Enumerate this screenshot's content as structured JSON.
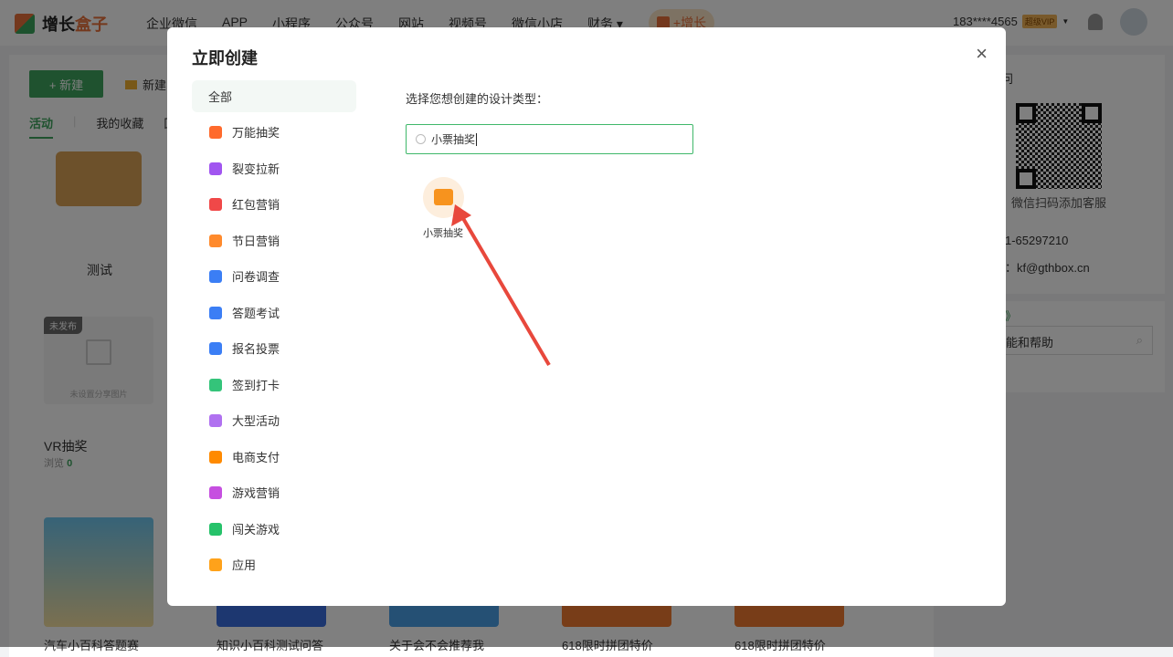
{
  "header": {
    "logo_a": "增长",
    "logo_b": "盒子",
    "nav": [
      "企业微信",
      "APP",
      "小程序",
      "公众号",
      "网站",
      "视频号",
      "微信小店",
      "财务 ▾"
    ],
    "grow": "+增长",
    "user": "183****4565",
    "vip": "超级VIP"
  },
  "page": {
    "new_btn": "+ 新建",
    "new_folder": "新建",
    "tabs": [
      "活动",
      "我的收藏",
      "回"
    ],
    "folder": "测试",
    "card1": {
      "tag": "未发布",
      "placeholder": "未设置分享图片",
      "title": "VR抽奖",
      "views_label": "浏览",
      "views": "0"
    },
    "cards": [
      "汽车小百科答题赛",
      "知识小百科测试问答",
      "关于会不会推荐我",
      "618限时拼团特价",
      "618限时拼团特价"
    ]
  },
  "right": {
    "title": "问",
    "qr_label": "微信扫码添加客服",
    "phone": "1-65297210",
    "email": "：kf@gthbox.cn",
    "help_title": "》",
    "help_search": "能和帮助"
  },
  "modal": {
    "title": "立即创建",
    "close": "×",
    "categories": [
      {
        "label": "全部",
        "color": ""
      },
      {
        "label": "万能抽奖",
        "color": "#ff6a2c"
      },
      {
        "label": "裂变拉新",
        "color": "#a155f0"
      },
      {
        "label": "红包营销",
        "color": "#f04848"
      },
      {
        "label": "节日营销",
        "color": "#ff8a2c"
      },
      {
        "label": "问卷调查",
        "color": "#3b7ef5"
      },
      {
        "label": "答题考试",
        "color": "#3b7ef5"
      },
      {
        "label": "报名投票",
        "color": "#3b7ef5"
      },
      {
        "label": "签到打卡",
        "color": "#34c47a"
      },
      {
        "label": "大型活动",
        "color": "#b071f0"
      },
      {
        "label": "电商支付",
        "color": "#ff8a00"
      },
      {
        "label": "游戏营销",
        "color": "#c64fe0"
      },
      {
        "label": "闯关游戏",
        "color": "#26c26a"
      },
      {
        "label": "应用",
        "color": "#ffa21a"
      }
    ],
    "prompt": "选择您想创建的设计类型：",
    "search_value": "小票抽奖",
    "result": "小票抽奖"
  }
}
